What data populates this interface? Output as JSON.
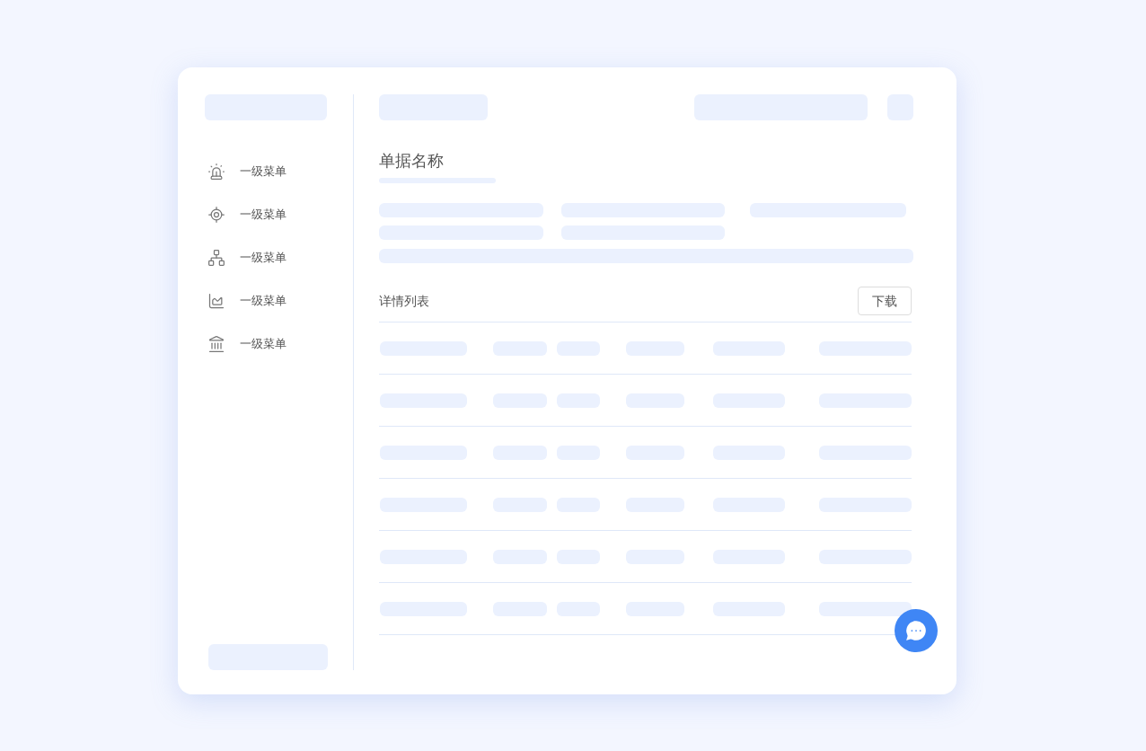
{
  "sidebar": {
    "items": [
      {
        "label": "一级菜单",
        "kind": "siren"
      },
      {
        "label": "一级菜单",
        "kind": "target"
      },
      {
        "label": "一级菜单",
        "kind": "network"
      },
      {
        "label": "一级菜单",
        "kind": "chart"
      },
      {
        "label": "一级菜单",
        "kind": "bank"
      }
    ]
  },
  "document": {
    "title": "单据名称"
  },
  "details": {
    "title": "详情列表",
    "button": "下载"
  },
  "table_rows": [
    {
      "kind": "placeholder"
    },
    {
      "kind": "placeholder"
    },
    {
      "kind": "placeholder"
    },
    {
      "kind": "placeholder"
    },
    {
      "kind": "placeholder"
    },
    {
      "kind": "placeholder"
    }
  ]
}
